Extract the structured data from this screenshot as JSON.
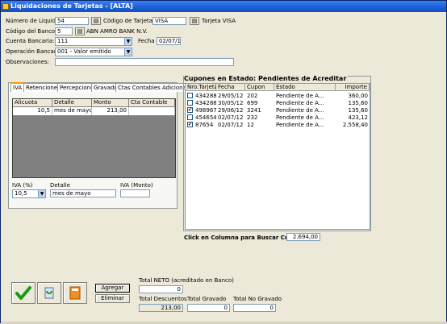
{
  "window": {
    "title": "Liquidaciones de Tarjetas - [ALTA]"
  },
  "header": {
    "numero_label": "Número de Liquidación",
    "numero_value": "54",
    "codigo_tarjeta_label": "Código de Tarjeta",
    "codigo_tarjeta_value": "VISA",
    "tarjeta_name": "Tarjeta VISA",
    "codigo_banco_label": "Código del Banco:",
    "codigo_banco_value": "5",
    "banco_name": "ABN AMRO BANK N.V.",
    "cuenta_label": "Cuenta Bancaria:",
    "cuenta_value": "111",
    "fecha_label": "Fecha",
    "fecha_value": "02/07/12",
    "operacion_label": "Operación Bancaria:",
    "operacion_value": "001 - Valor emitido",
    "observaciones_label": "Observaciones:",
    "observaciones_value": ""
  },
  "tabs": [
    {
      "label": "IVA"
    },
    {
      "label": "Retenciones"
    },
    {
      "label": "Percepciones"
    },
    {
      "label": "Gravado"
    },
    {
      "label": "Ctas Contables Adicionales"
    }
  ],
  "left_grid": {
    "columns": [
      "Alicuota",
      "Detalle",
      "Monto",
      "Cta Contable"
    ],
    "rows": [
      {
        "alicuota": "10,5",
        "detalle": "mes de mayo",
        "monto": "213,00",
        "cta": ""
      }
    ]
  },
  "iva_form": {
    "iva_pct_label": "IVA (%)",
    "iva_pct_value": "10,5",
    "detalle_label": "Detalle",
    "detalle_value": "mes de mayo",
    "iva_monto_label": "IVA (Monto)",
    "iva_monto_value": ""
  },
  "cupones": {
    "title": "Cupones en Estado: Pendientes de Acreditar",
    "columns": [
      "Nro.Tarjeta",
      "Fecha",
      "Cupon",
      "Estado",
      "Importe"
    ],
    "rows": [
      {
        "checked": false,
        "tarjeta": "434288...",
        "fecha": "29/05/12",
        "cupon": "202",
        "estado": "Pendiente de A...",
        "importe": "360,00"
      },
      {
        "checked": false,
        "tarjeta": "434288...",
        "fecha": "30/05/12",
        "cupon": "699",
        "estado": "Pendiente de A...",
        "importe": "135,60"
      },
      {
        "checked": true,
        "tarjeta": "498967",
        "fecha": "29/06/12",
        "cupon": "3241",
        "estado": "Pendiente de A...",
        "importe": "135,60"
      },
      {
        "checked": false,
        "tarjeta": "454654...",
        "fecha": "02/07/12",
        "cupon": "232",
        "estado": "Pendiente de A...",
        "importe": "423,12"
      },
      {
        "checked": true,
        "tarjeta": "87654",
        "fecha": "02/07/12",
        "cupon": "12",
        "estado": "Pendiente de A...",
        "importe": "2.558,40"
      }
    ],
    "buscar_label": "Click en Columna para Buscar Cupones",
    "total_value": "2.694,00"
  },
  "actions": {
    "agregar": "Agregar",
    "eliminar": "Eliminar"
  },
  "totals": {
    "neto_label": "Total NETO (acreditado en Banco)",
    "neto_value": "0",
    "descuentos_label": "Total Descuentos",
    "descuentos_value": "213,00",
    "gravado_label": "Total Gravado",
    "gravado_value": "0",
    "no_gravado_label": "Total No Gravado",
    "no_gravado_value": "0"
  }
}
